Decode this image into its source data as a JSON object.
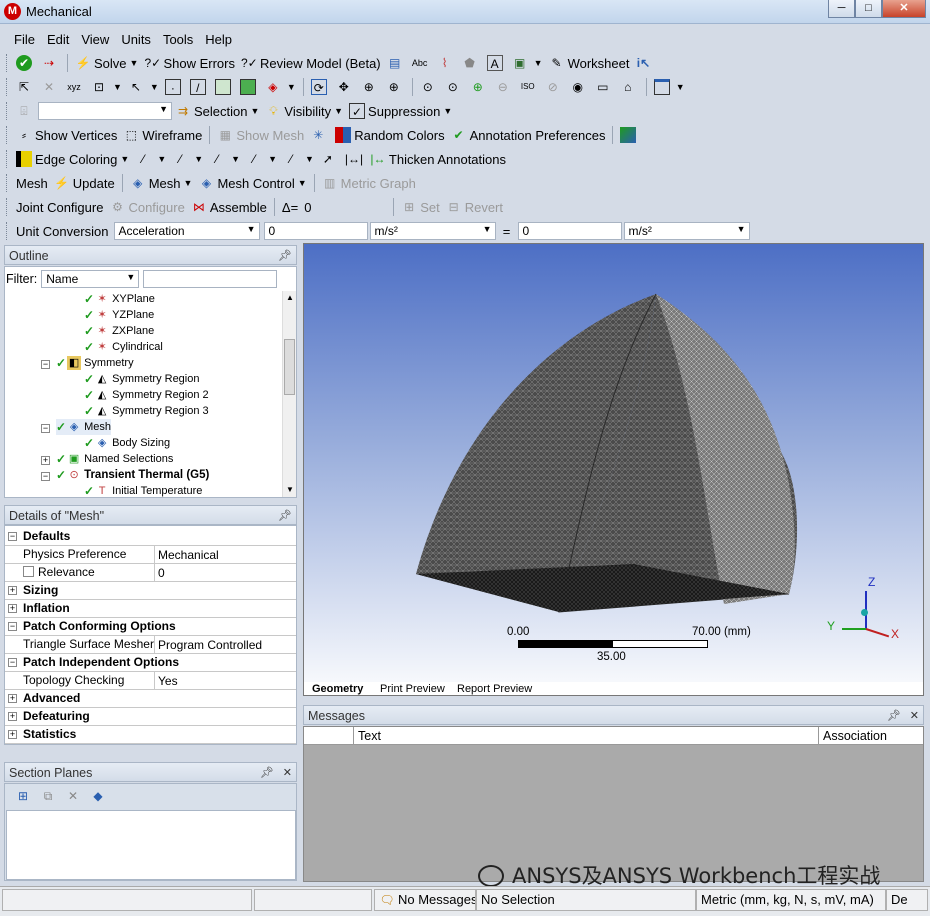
{
  "window": {
    "title": "Mechanical",
    "app_icon_letter": "M",
    "min": "─",
    "max": "□",
    "close": "✕"
  },
  "menu": [
    "File",
    "Edit",
    "View",
    "Units",
    "Tools",
    "Help"
  ],
  "toolbar1": {
    "solve": "Solve",
    "show_errors": "Show Errors",
    "review_model": "Review Model (Beta)",
    "worksheet": "Worksheet"
  },
  "toolbar3": {
    "selection": "Selection",
    "visibility": "Visibility",
    "suppression": "Suppression"
  },
  "toolbar4": {
    "show_vertices": "Show Vertices",
    "wireframe": "Wireframe",
    "show_mesh": "Show Mesh",
    "random_colors": "Random Colors",
    "annotation_preferences": "Annotation Preferences"
  },
  "toolbar5": {
    "edge_coloring": "Edge Coloring",
    "thicken_annotations": "Thicken Annotations"
  },
  "toolbar6": {
    "mesh": "Mesh",
    "update": "Update",
    "mesh_menu": "Mesh",
    "mesh_control": "Mesh Control",
    "metric_graph": "Metric Graph"
  },
  "toolbar7": {
    "joint_configure": "Joint Configure",
    "configure": "Configure",
    "assemble": "Assemble",
    "delta_label": "Δ=",
    "delta_value": "0",
    "set": "Set",
    "revert": "Revert"
  },
  "toolbar8": {
    "unit_conversion": "Unit Conversion",
    "quantity": "Acceleration",
    "value_in": "0",
    "unit_in": "m/s²",
    "equals": "=",
    "value_out": "0",
    "unit_out": "m/s²"
  },
  "outline": {
    "title": "Outline",
    "filter_label": "Filter:",
    "filter_value": "Name",
    "tree": [
      {
        "label": "XYPlane",
        "icon": "coordinate-system-icon"
      },
      {
        "label": "YZPlane",
        "icon": "coordinate-system-icon"
      },
      {
        "label": "ZXPlane",
        "icon": "coordinate-system-icon"
      },
      {
        "label": "Cylindrical",
        "icon": "coordinate-system-icon"
      },
      {
        "label": "Symmetry",
        "icon": "symmetry-folder-icon"
      },
      {
        "label": "Symmetry Region",
        "icon": "symmetry-region-icon"
      },
      {
        "label": "Symmetry Region 2",
        "icon": "symmetry-region-icon"
      },
      {
        "label": "Symmetry Region 3",
        "icon": "symmetry-region-icon"
      },
      {
        "label": "Mesh",
        "icon": "mesh-icon"
      },
      {
        "label": "Body Sizing",
        "icon": "body-sizing-icon"
      },
      {
        "label": "Named Selections",
        "icon": "named-selections-icon"
      },
      {
        "label": "Transient Thermal (G5)",
        "icon": "transient-thermal-icon"
      },
      {
        "label": "Initial Temperature",
        "icon": "initial-temperature-icon"
      }
    ]
  },
  "details": {
    "title": "Details of \"Mesh\"",
    "rows": [
      {
        "type": "group",
        "label": "Defaults",
        "expanded": true
      },
      {
        "type": "prop",
        "label": "Physics Preference",
        "value": "Mechanical"
      },
      {
        "type": "prop",
        "label": "Relevance",
        "value": "0",
        "checkbox": true
      },
      {
        "type": "group",
        "label": "Sizing",
        "expanded": false
      },
      {
        "type": "group",
        "label": "Inflation",
        "expanded": false
      },
      {
        "type": "group",
        "label": "Patch Conforming Options",
        "expanded": true
      },
      {
        "type": "prop",
        "label": "Triangle Surface Mesher",
        "value": "Program Controlled"
      },
      {
        "type": "group",
        "label": "Patch Independent Options",
        "expanded": true
      },
      {
        "type": "prop",
        "label": "Topology Checking",
        "value": "Yes"
      },
      {
        "type": "group",
        "label": "Advanced",
        "expanded": false
      },
      {
        "type": "group",
        "label": "Defeaturing",
        "expanded": false
      },
      {
        "type": "group",
        "label": "Statistics",
        "expanded": false
      }
    ]
  },
  "section_planes": {
    "title": "Section Planes"
  },
  "viewport": {
    "scale_min": "0.00",
    "scale_max": "70.00 (mm)",
    "scale_mid": "35.00",
    "axis_x": "X",
    "axis_y": "Y",
    "axis_z": "Z",
    "tabs": [
      "Geometry",
      "Print Preview",
      "Report Preview"
    ]
  },
  "messages": {
    "title": "Messages",
    "columns": [
      "Text",
      "Association"
    ]
  },
  "status": {
    "messages": "No Messages",
    "selection": "No Selection",
    "units": "Metric (mm, kg, N, s, mV, mA)",
    "extra": "De"
  },
  "watermark": "ANSYS及ANSYS Workbench工程实战",
  "colors": {
    "accent": "#c00000",
    "check": "#1f9b1f",
    "viewport_top": "#4d6fc5",
    "viewport_bottom": "#f6f8fc"
  }
}
